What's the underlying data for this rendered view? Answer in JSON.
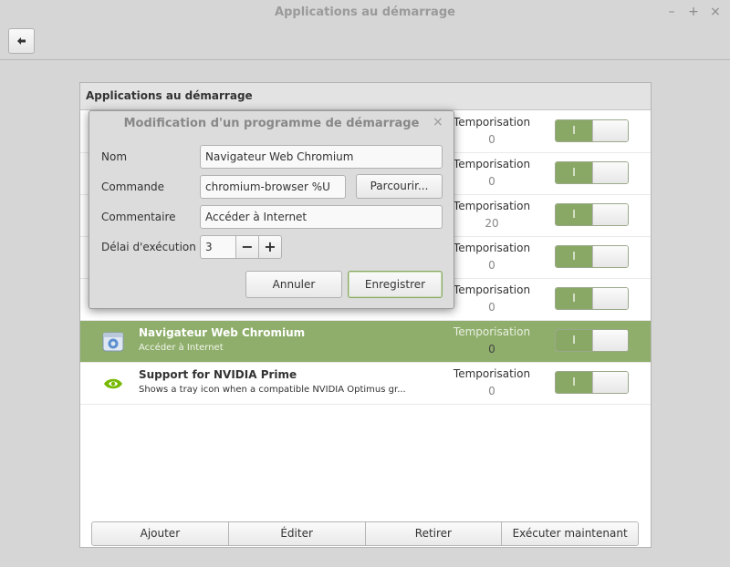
{
  "window": {
    "title": "Applications au démarrage",
    "minimize_glyph": "–",
    "maximize_glyph": "+",
    "close_glyph": "×"
  },
  "toolbar": {
    "back_icon": "back-arrow-icon"
  },
  "panel": {
    "header": "Applications au démarrage"
  },
  "apps": [
    {
      "name": "",
      "description": "",
      "delay_label": "Temporisation",
      "delay_value": "0",
      "switch_label": "I",
      "enabled": true,
      "selected": false
    },
    {
      "name": "",
      "description": "",
      "delay_label": "Temporisation",
      "delay_value": "0",
      "switch_label": "I",
      "enabled": true,
      "selected": false
    },
    {
      "name": "",
      "description": "",
      "delay_label": "Temporisation",
      "delay_value": "20",
      "switch_label": "I",
      "enabled": true,
      "selected": false
    },
    {
      "name": "",
      "description": "",
      "delay_label": "Temporisation",
      "delay_value": "0",
      "switch_label": "I",
      "enabled": true,
      "selected": false
    },
    {
      "name": "",
      "description": "",
      "delay_label": "Temporisation",
      "delay_value": "0",
      "switch_label": "I",
      "enabled": true,
      "selected": false
    },
    {
      "name": "Navigateur Web Chromium",
      "description": "Accéder à Internet",
      "delay_label": "Temporisation",
      "delay_value": "0",
      "switch_label": "I",
      "enabled": true,
      "selected": true,
      "icon": "chromium-icon"
    },
    {
      "name": "Support for NVIDIA Prime",
      "description": "Shows a tray icon when a compatible NVIDIA Optimus gr...",
      "delay_label": "Temporisation",
      "delay_value": "0",
      "switch_label": "I",
      "enabled": true,
      "selected": false,
      "icon": "nvidia-icon"
    }
  ],
  "footer": {
    "add": "Ajouter",
    "edit": "Éditer",
    "remove": "Retirer",
    "run_now": "Exécuter maintenant"
  },
  "dialog": {
    "title": "Modification d'un programme de démarrage",
    "close_glyph": "×",
    "name_label": "Nom",
    "name_value": "Navigateur Web Chromium",
    "command_label": "Commande",
    "command_value": "chromium-browser %U",
    "browse": "Parcourir...",
    "comment_label": "Commentaire",
    "comment_value": "Accéder à Internet",
    "delay_label": "Délai d'exécution",
    "delay_value": "3",
    "minus": "−",
    "plus": "+",
    "cancel": "Annuler",
    "save": "Enregistrer"
  },
  "colors": {
    "accent": "#8fae6b",
    "switch_on": "#8aa865",
    "window_bg": "#d6d6d6"
  }
}
